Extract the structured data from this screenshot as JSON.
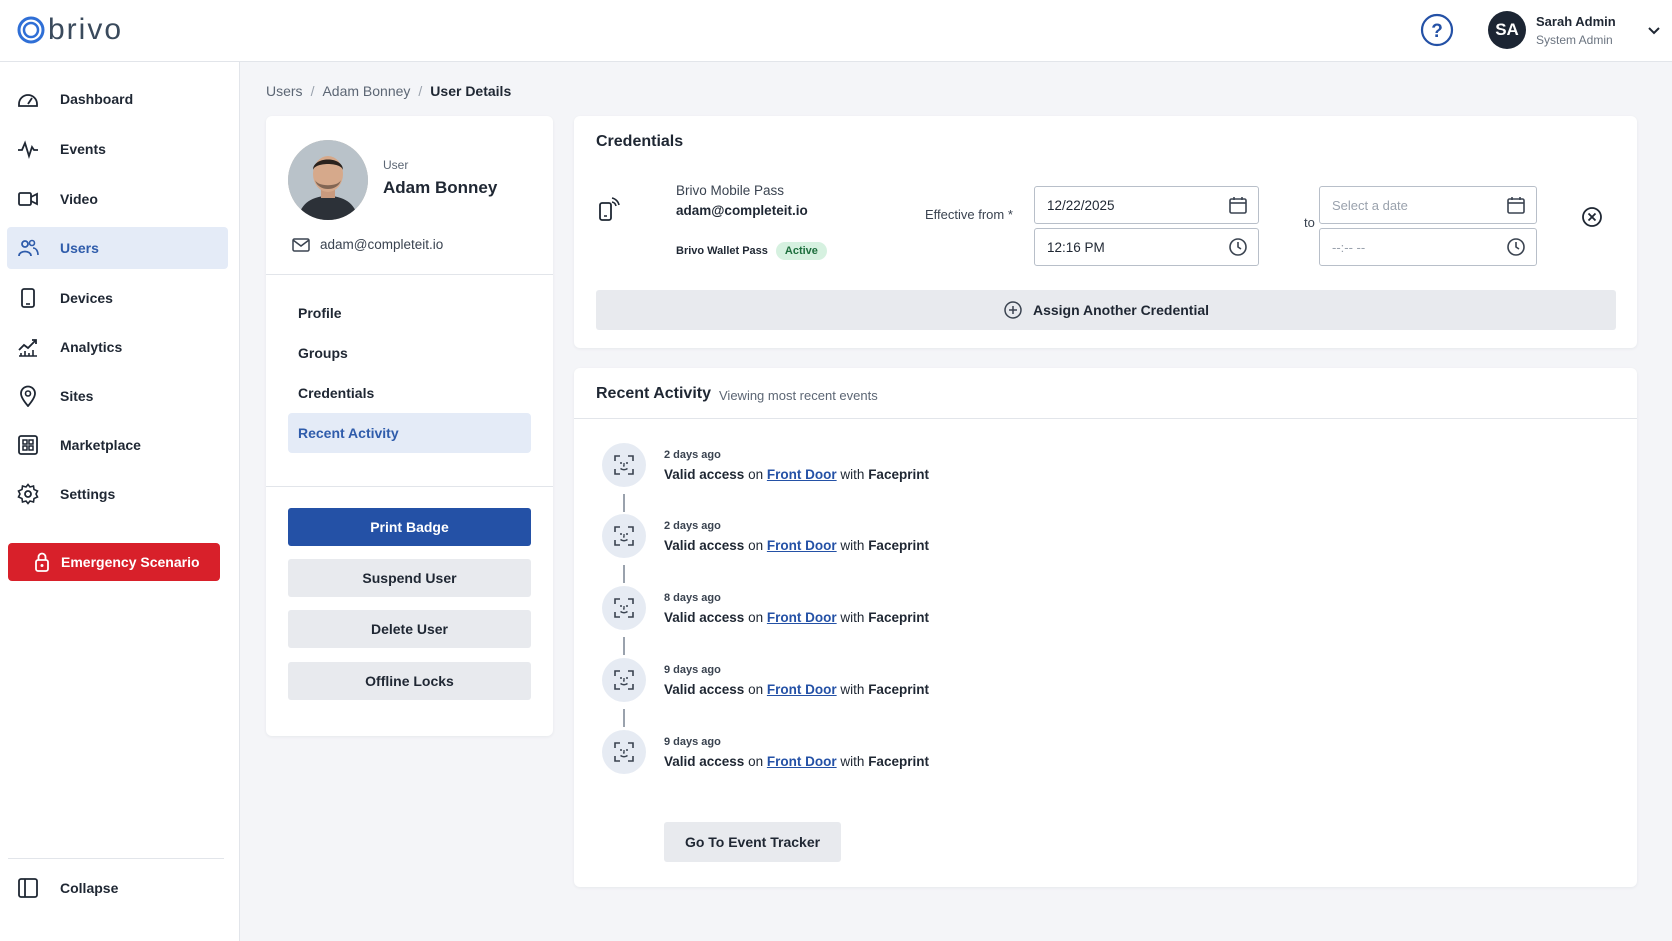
{
  "header": {
    "logo_text": "brivo",
    "user": {
      "initials": "SA",
      "name": "Sarah Admin",
      "role": "System Admin"
    }
  },
  "sidebar": {
    "items": [
      {
        "label": "Dashboard",
        "icon": "dashboard-icon",
        "active": false
      },
      {
        "label": "Events",
        "icon": "events-icon",
        "active": false
      },
      {
        "label": "Video",
        "icon": "video-icon",
        "active": false
      },
      {
        "label": "Users",
        "icon": "users-icon",
        "active": true
      },
      {
        "label": "Devices",
        "icon": "devices-icon",
        "active": false
      },
      {
        "label": "Analytics",
        "icon": "analytics-icon",
        "active": false
      },
      {
        "label": "Sites",
        "icon": "sites-icon",
        "active": false
      },
      {
        "label": "Marketplace",
        "icon": "marketplace-icon",
        "active": false
      },
      {
        "label": "Settings",
        "icon": "settings-icon",
        "active": false
      }
    ],
    "emergency_label": "Emergency Scenario",
    "collapse_label": "Collapse",
    "accent": "#2f5cab",
    "emergency_color": "#d8202a"
  },
  "breadcrumb": [
    "Users",
    "Adam Bonney",
    "User Details"
  ],
  "user_card": {
    "label": "User",
    "name": "Adam Bonney",
    "email": "adam@completeit.io",
    "tabs": [
      "Profile",
      "Groups",
      "Credentials",
      "Recent Activity"
    ],
    "active_tab": "Recent Activity",
    "actions": [
      "Print Badge",
      "Suspend User",
      "Delete User",
      "Offline Locks"
    ]
  },
  "credentials": {
    "title": "Credentials",
    "type": "Brivo Mobile Pass",
    "email": "adam@completeit.io",
    "wallet_label": "Brivo Wallet Pass",
    "status": "Active",
    "effective_label": "Effective from *",
    "from_date": "12/22/2025",
    "from_time": "12:16 PM",
    "to_label": "to",
    "to_date_placeholder": "Select a date",
    "to_time_placeholder": "--:-- --",
    "assign_label": "Assign Another Credential"
  },
  "activity": {
    "title": "Recent Activity",
    "subtitle": "Viewing most recent events",
    "events": [
      {
        "time": "2 days ago",
        "result": "Valid access",
        "on": "on",
        "door": "Front Door",
        "with": "with",
        "method": "Faceprint"
      },
      {
        "time": "2 days ago",
        "result": "Valid access",
        "on": "on",
        "door": "Front Door",
        "with": "with",
        "method": "Faceprint"
      },
      {
        "time": "8 days ago",
        "result": "Valid access",
        "on": "on",
        "door": "Front Door",
        "with": "with",
        "method": "Faceprint"
      },
      {
        "time": "9 days ago",
        "result": "Valid access",
        "on": "on",
        "door": "Front Door",
        "with": "with",
        "method": "Faceprint"
      },
      {
        "time": "9 days ago",
        "result": "Valid access",
        "on": "on",
        "door": "Front Door",
        "with": "with",
        "method": "Faceprint"
      }
    ],
    "tracker_label": "Go To Event Tracker"
  }
}
